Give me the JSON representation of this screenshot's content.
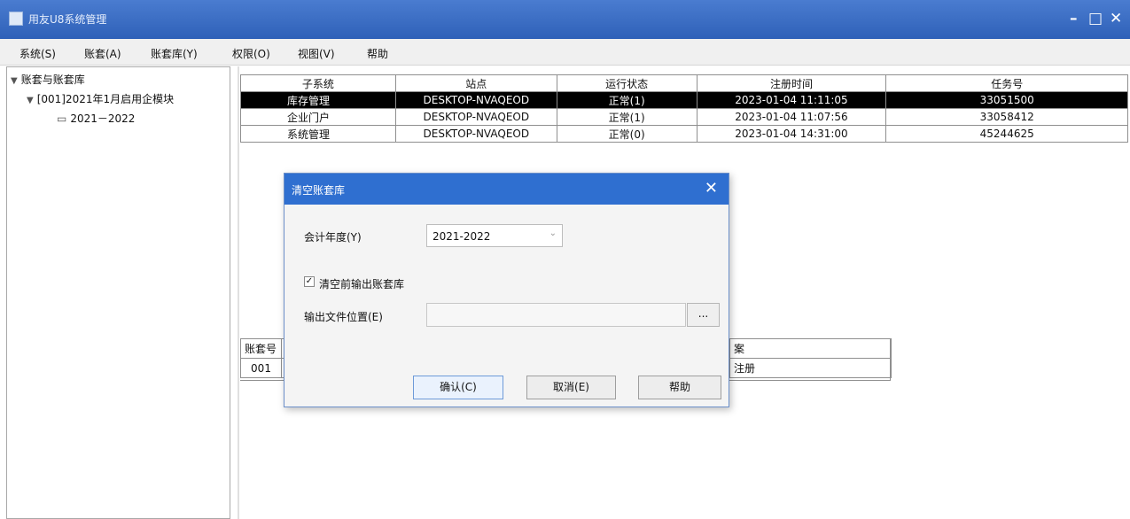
{
  "window": {
    "title": "用友U8系统管理",
    "min_label": "–",
    "max_label": "□",
    "close_label": "✕"
  },
  "menu": [
    "系统(S)",
    "账套(A)",
    "账套库(Y)",
    "权限(O)",
    "视图(V)",
    "帮助"
  ],
  "tree": {
    "root": "账套与账套库",
    "child": "[001]2021年1月启用企模块",
    "leaf": "2021－2022"
  },
  "grid": {
    "headers": [
      "子系统",
      "站点",
      "运行状态",
      "注册时间",
      "任务号"
    ],
    "rows": [
      [
        "库存管理",
        "DESKTOP-NVAQEOD",
        "正常(1)",
        "2023-01-04 11:11:05",
        "33051500"
      ],
      [
        "企业门户",
        "DESKTOP-NVAQEOD",
        "正常(1)",
        "2023-01-04 11:07:56",
        "33058412"
      ],
      [
        "系统管理",
        "DESKTOP-NVAQEOD",
        "正常(0)",
        "2023-01-04 14:31:00",
        "45244625"
      ]
    ]
  },
  "lower": {
    "col1_header": "账套号",
    "col1_value": "001",
    "col2_header": "案",
    "col2_value": "注册"
  },
  "dialog": {
    "title": "清空账套库",
    "close_label": "✕",
    "year_label": "会计年度(Y)",
    "year_value": "2021-2022",
    "checkbox_label": "清空前输出账套库",
    "checkbox_checked": true,
    "path_label": "输出文件位置(E)",
    "path_value": "",
    "browse_label": "...",
    "ok_label": "确认(C)",
    "cancel_label": "取消(E)",
    "help_label": "帮助"
  }
}
